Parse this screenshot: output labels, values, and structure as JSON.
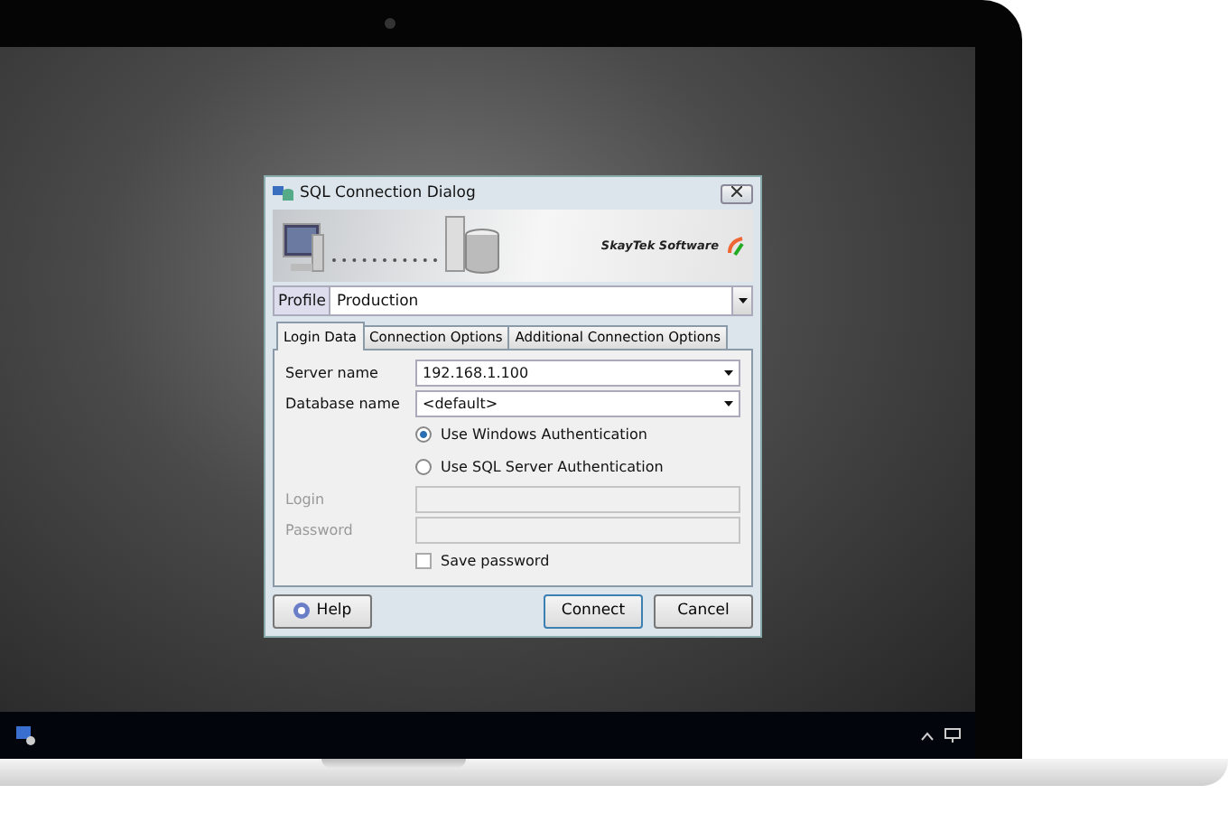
{
  "window": {
    "title": "SQL Connection Dialog"
  },
  "banner": {
    "brand": "SkayTek Software"
  },
  "profile": {
    "label": "Profile",
    "value": "Production"
  },
  "tabs": [
    {
      "label": "Login Data",
      "selected": true
    },
    {
      "label": "Connection Options",
      "selected": false
    },
    {
      "label": "Additional Connection Options",
      "selected": false
    }
  ],
  "fields": [
    {
      "label": "Server name",
      "value": "192.168.1.100",
      "kind": "dropdown",
      "disabled": false
    },
    {
      "label": "Database name",
      "value": "<default>",
      "kind": "dropdown",
      "disabled": false
    }
  ],
  "auth_options": [
    {
      "label": "Use Windows Authentication",
      "selected": true
    },
    {
      "label": "Use SQL Server Authentication",
      "selected": false
    }
  ],
  "credentials": [
    {
      "label": "Login",
      "disabled": true
    },
    {
      "label": "Password",
      "disabled": true
    }
  ],
  "save_password": {
    "label": "Save password",
    "checked": false
  },
  "buttons": [
    {
      "label": "Help",
      "kind": "help"
    },
    {
      "label": "Connect",
      "kind": "default"
    },
    {
      "label": "Cancel",
      "kind": "normal"
    }
  ]
}
